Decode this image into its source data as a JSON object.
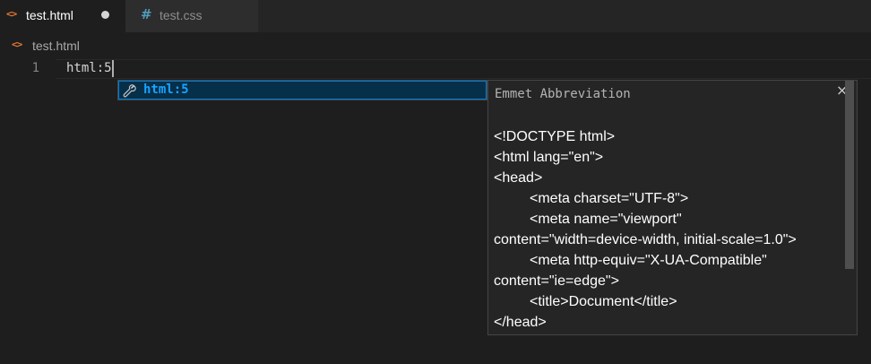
{
  "tabs": [
    {
      "label": "test.html",
      "icon": "html-file-icon",
      "modified": true,
      "active": true
    },
    {
      "label": "test.css",
      "icon": "css-file-icon",
      "active": false
    }
  ],
  "tab_icons": {
    "html": "<>",
    "css": "#"
  },
  "breadcrumb": {
    "icon": "<>",
    "file": "test.html"
  },
  "editor": {
    "line_number": "1",
    "line_text": "html:5"
  },
  "suggest": {
    "item_label": "html:5",
    "item_icon": "wrench-icon"
  },
  "details": {
    "title": "Emmet Abbreviation",
    "close": "×",
    "lines": [
      "<!DOCTYPE html>",
      "<html lang=\"en\">",
      "<head>",
      "<meta charset=\"UTF-8\">",
      "<meta name=\"viewport\"",
      "content=\"width=device-width, initial-scale=1.0\">",
      "<meta http-equiv=\"X-UA-Compatible\"",
      "content=\"ie=edge\">",
      "<title>Document</title>",
      "</head>"
    ]
  },
  "colors": {
    "editor_bg": "#1e1e1e",
    "tab_inactive_bg": "#2d2d2d",
    "html_icon": "#e37933",
    "css_icon": "#519aba",
    "suggest_focus": "#062f4a",
    "suggest_highlight": "#18a3ff"
  }
}
